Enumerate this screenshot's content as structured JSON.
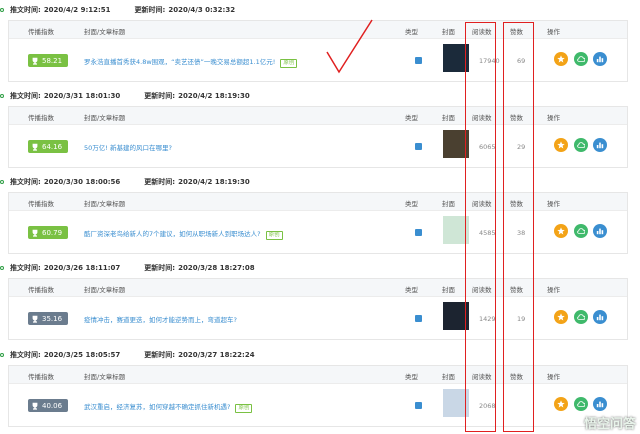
{
  "labels": {
    "publish_time": "推文时间:",
    "update_time": "更新时间:",
    "col_score": "传播指数",
    "col_title": "封面/文章标题",
    "col_type": "类型",
    "col_cover": "封面",
    "col_reads": "阅读数",
    "col_likes": "赞数",
    "col_actions": "操作"
  },
  "articles": [
    {
      "publish": "2020/4/2 9:12:51",
      "update": "2020/4/3 0:32:32",
      "score": "58.21",
      "title": "罗永浩直播首秀获4.8w围观，“卖艺还债”一晚交易总额超1.1亿元!",
      "tag": "原创",
      "reads": "17940",
      "likes": "69",
      "score_color": "green",
      "cover_color": "#1b2a3a"
    },
    {
      "publish": "2020/3/31 18:01:30",
      "update": "2020/4/2 18:19:30",
      "score": "64.16",
      "title": "50万亿! 新基建的风口在哪里?",
      "tag": "",
      "reads": "6065",
      "likes": "29",
      "score_color": "green",
      "cover_color": "#4a4030"
    },
    {
      "publish": "2020/3/30 18:00:56",
      "update": "2020/4/2 18:19:30",
      "score": "60.79",
      "title": "酷厂资深老鸟给新人的7个建议，如何从职场新人到职场达人?",
      "tag": "原创",
      "reads": "4585",
      "likes": "38",
      "score_color": "green",
      "cover_color": "#cfe6d6"
    },
    {
      "publish": "2020/3/26 18:11:07",
      "update": "2020/3/28 18:27:08",
      "score": "35.16",
      "title": "疫情冲击，赛道更迭，如何才能逆势而上，弯道超车?",
      "tag": "",
      "reads": "1429",
      "likes": "19",
      "score_color": "gray",
      "cover_color": "#1c2430"
    },
    {
      "publish": "2020/3/25 18:05:57",
      "update": "2020/3/27 18:22:24",
      "score": "40.06",
      "title": "武汉重启，经济复苏，如何穿越不确定抓住新机遇?",
      "tag": "原创",
      "reads": "2068",
      "likes": "",
      "score_color": "gray",
      "cover_color": "#c9d7e6"
    }
  ],
  "watermark": "悟空问答",
  "colors": {
    "accent_green": "#7ac143",
    "accent_gray": "#6b7c8e",
    "link_blue": "#3a8ed0",
    "annotation_red": "#e02020"
  }
}
